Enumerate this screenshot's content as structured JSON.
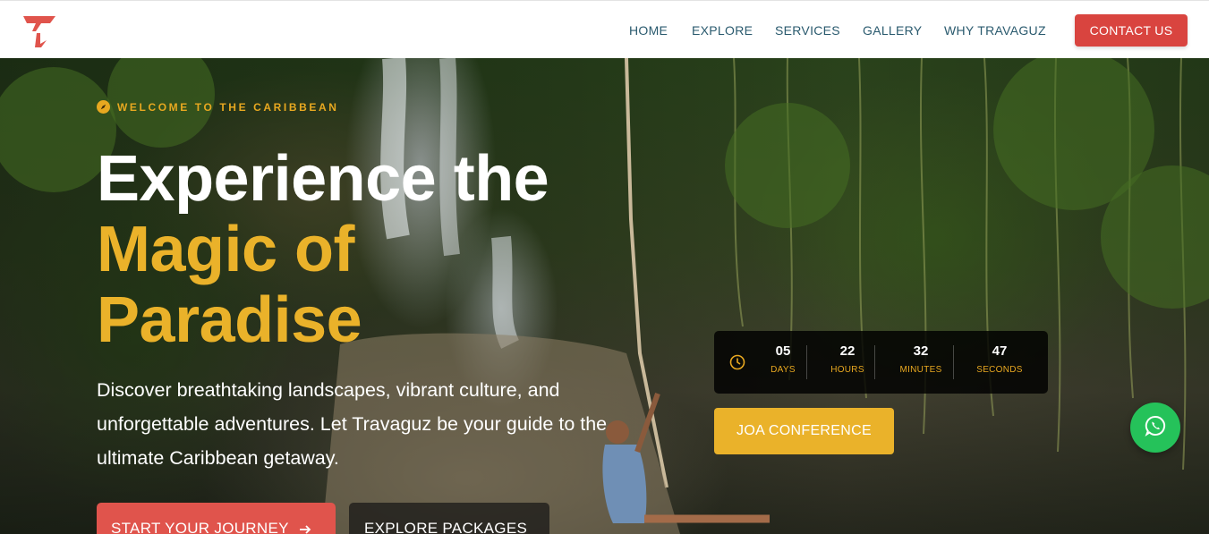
{
  "header": {
    "nav": [
      {
        "label": "HOME"
      },
      {
        "label": "EXPLORE"
      },
      {
        "label": "SERVICES"
      },
      {
        "label": "GALLERY"
      },
      {
        "label": "WHY TRAVAGUZ"
      }
    ],
    "contact_label": "CONTACT US"
  },
  "hero": {
    "eyebrow": "WELCOME TO THE CARIBBEAN",
    "title_line1": "Experience the",
    "title_line2": "Magic of",
    "title_line3": "Paradise",
    "description": "Discover breathtaking landscapes, vibrant culture, and unforgettable adventures. Let Travaguz be your guide to the ultimate Caribbean getaway.",
    "primary_button": "START YOUR JOURNEY",
    "secondary_button": "EXPLORE PACKAGES"
  },
  "countdown": {
    "days": "05",
    "days_label": "DAYS",
    "hours": "22",
    "hours_label": "HOURS",
    "minutes": "32",
    "minutes_label": "MINUTES",
    "seconds": "47",
    "seconds_label": "SECONDS"
  },
  "event_button": "JOA CONFERENCE",
  "colors": {
    "brand_red": "#d9443f",
    "accent_gold": "#eab22a",
    "whatsapp_green": "#25c25a",
    "nav_text": "#2a5a6e"
  },
  "icons": {
    "logo": "travaguz-logo",
    "eyebrow": "compass-icon",
    "countdown": "clock-icon",
    "primary_button": "arrow-right-icon",
    "floating": "whatsapp-icon"
  }
}
